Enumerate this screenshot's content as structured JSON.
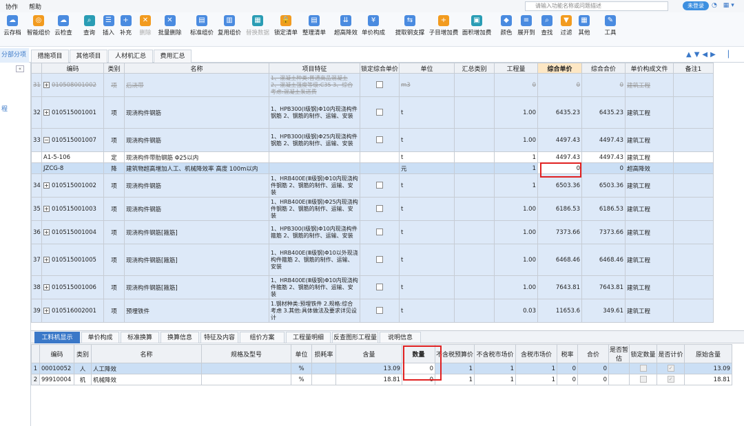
{
  "menu": [
    "协作",
    "帮助"
  ],
  "search": {
    "placeholder": "请输入功能名称或问题描述"
  },
  "login": "未登录",
  "toolbar": [
    {
      "label": "云存档",
      "icon": "cloud-save-icon"
    },
    {
      "label": "智能组价",
      "icon": "smart-price-icon"
    },
    {
      "label": "云检查",
      "icon": "cloud-check-icon"
    },
    {
      "label": "查询",
      "icon": "query-icon"
    },
    {
      "label": "插入",
      "icon": "insert-icon"
    },
    {
      "label": "补充",
      "icon": "supplement-icon"
    },
    {
      "label": "删除",
      "icon": "delete-icon",
      "disabled": true
    },
    {
      "label": "批量删除",
      "icon": "batch-delete-icon"
    },
    {
      "label": "标准组价",
      "icon": "standard-price-icon"
    },
    {
      "label": "复用组价",
      "icon": "reuse-price-icon"
    },
    {
      "label": "替换数据",
      "icon": "replace-data-icon",
      "disabled": true
    },
    {
      "label": "锁定清单",
      "icon": "lock-list-icon"
    },
    {
      "label": "整理清单",
      "icon": "organize-list-icon"
    },
    {
      "label": "超高降效",
      "icon": "high-efficiency-icon"
    },
    {
      "label": "单价构成",
      "icon": "unit-price-icon"
    },
    {
      "label": "提取钢支撑",
      "icon": "steel-support-icon"
    },
    {
      "label": "子目增加费",
      "icon": "sub-item-fee-icon"
    },
    {
      "label": "面积增加费",
      "icon": "area-fee-icon"
    },
    {
      "label": "颜色",
      "icon": "color-icon"
    },
    {
      "label": "展开到",
      "icon": "expand-icon"
    },
    {
      "label": "查找",
      "icon": "find-icon"
    },
    {
      "label": "过滤",
      "icon": "filter-icon"
    },
    {
      "label": "其他",
      "icon": "other-icon"
    },
    {
      "label": "工具",
      "icon": "tool-icon"
    }
  ],
  "left_tab": "分部分项",
  "page_tabs": [
    "措施项目",
    "其他项目",
    "人材机汇总",
    "费用汇总"
  ],
  "left_panel_label": "程",
  "grid": {
    "headers": [
      "",
      "编码",
      "类别",
      "名称",
      "项目特征",
      "锁定综合单价",
      "单位",
      "汇总类别",
      "工程量",
      "综合单价",
      "综合合价",
      "单价构成文件",
      "备注1"
    ],
    "rows": [
      {
        "no": "31",
        "code": "010508001002",
        "type": "项",
        "name": "后浇带",
        "feat": "1、混凝土种类:普通商品混凝土 2、混凝土强度等级:C35 3、综合考虑:混凝土泵送费",
        "unit": "m3",
        "qty": "0",
        "price": "0",
        "total": "0",
        "file": "建筑工程",
        "strike": true
      },
      {
        "no": "32",
        "code": "010515001001",
        "type": "项",
        "name": "现浇构件钢筋",
        "feat": "1、HPB300(Ⅰ级钢)Φ10内现浇构件钢筋 2、钢筋的制作、运输、安装",
        "unit": "t",
        "qty": "1.00",
        "price": "6435.23",
        "total": "6435.23",
        "file": "建筑工程"
      },
      {
        "no": "33",
        "code": "010515001007",
        "type": "项",
        "name": "现浇构件钢筋",
        "feat": "1、HPB300(Ⅰ级钢)Φ25内现浇构件钢筋 2、钢筋的制作、运输、安装",
        "unit": "t",
        "qty": "1.00",
        "price": "4497.43",
        "total": "4497.43",
        "file": "建筑工程",
        "expanded": true
      },
      {
        "no": "",
        "code": "A1-5-106",
        "type": "定",
        "name": "现浇构件带肋钢筋 Φ25以内",
        "feat": "",
        "unit": "t",
        "qty": "1",
        "price": "4497.43",
        "total": "4497.43",
        "file": "建筑工程",
        "child": true
      },
      {
        "no": "",
        "code": "JZCG-8",
        "type": "降",
        "name": "建筑物超高增加人工、机械降效率 高度 100m以内",
        "feat": "",
        "unit": "元",
        "qty": "1",
        "price": "0",
        "total": "0",
        "file": "超高降效",
        "child": true,
        "selected": true
      },
      {
        "no": "34",
        "code": "010515001002",
        "type": "项",
        "name": "现浇构件钢筋",
        "feat": "1、HRB400E(Ⅲ级钢)Φ10内现浇构件钢筋 2、钢筋的制作、运输、安装",
        "unit": "t",
        "qty": "1",
        "price": "6503.36",
        "total": "6503.36",
        "file": "建筑工程"
      },
      {
        "no": "35",
        "code": "010515001003",
        "type": "项",
        "name": "现浇构件钢筋",
        "feat": "1、HRB400E(Ⅲ级钢)Φ25内现浇构件钢筋 2、钢筋的制作、运输、安装",
        "unit": "t",
        "qty": "1.00",
        "price": "6186.53",
        "total": "6186.53",
        "file": "建筑工程"
      },
      {
        "no": "36",
        "code": "010515001004",
        "type": "项",
        "name": "现浇构件钢筋[箍筋]",
        "feat": "1、HPB300(Ⅰ级钢)Φ10内现浇构件箍筋 2、钢筋的制作、运输、安装",
        "unit": "t",
        "qty": "1.00",
        "price": "7373.66",
        "total": "7373.66",
        "file": "建筑工程"
      },
      {
        "no": "37",
        "code": "010515001005",
        "type": "项",
        "name": "现浇构件钢筋[箍筋]",
        "feat": "1、HRB400E(Ⅲ级钢)Φ10以外现浇构件箍筋 2、钢筋的制作、运输、安装",
        "unit": "t",
        "qty": "1.00",
        "price": "6468.46",
        "total": "6468.46",
        "file": "建筑工程"
      },
      {
        "no": "38",
        "code": "010515001006",
        "type": "项",
        "name": "现浇构件钢筋[箍筋]",
        "feat": "1、HRB400E(Ⅲ级钢)Φ10内现浇构件箍筋 2、钢筋的制作、运输、安装",
        "unit": "t",
        "qty": "1.00",
        "price": "7643.81",
        "total": "7643.81",
        "file": "建筑工程"
      },
      {
        "no": "39",
        "code": "010516002001",
        "type": "项",
        "name": "预埋铁件",
        "feat": "1.钢材种类:预埋铁件 2.规格:综合考虑 3.其他:具体做法及要求详见设计",
        "unit": "t",
        "qty": "0.03",
        "price": "11653.6",
        "total": "349.61",
        "file": "建筑工程"
      }
    ]
  },
  "bottom_tabs": [
    "工料机显示",
    "单价构成",
    "标准换算",
    "换算信息",
    "特征及内容",
    "组价方案",
    "工程量明细",
    "反查图形工程量",
    "说明信息"
  ],
  "grid2": {
    "headers": [
      "",
      "编码",
      "类别",
      "名称",
      "规格及型号",
      "单位",
      "损耗率",
      "含量",
      "数量",
      "不含税预算价",
      "不含税市场价",
      "含税市场价",
      "税率",
      "合价",
      "是否暂估",
      "锁定数量",
      "是否计价",
      "原始含量"
    ],
    "rows": [
      {
        "no": "1",
        "code": "00010052",
        "type": "人",
        "name": "人工降效",
        "unit": "%",
        "content": "13.09",
        "qty": "0",
        "p1": "1",
        "p2": "1",
        "p3": "1",
        "tax": "0",
        "total": "0",
        "orig": "13.09",
        "selected": true
      },
      {
        "no": "2",
        "code": "99910004",
        "type": "机",
        "name": "机械降效",
        "unit": "%",
        "content": "18.81",
        "qty": "0",
        "p1": "1",
        "p2": "1",
        "p3": "1",
        "tax": "0",
        "total": "0",
        "orig": "18.81"
      }
    ]
  },
  "colors": {
    "accent": "#3a78c8",
    "highlight_box": "#e02020"
  }
}
